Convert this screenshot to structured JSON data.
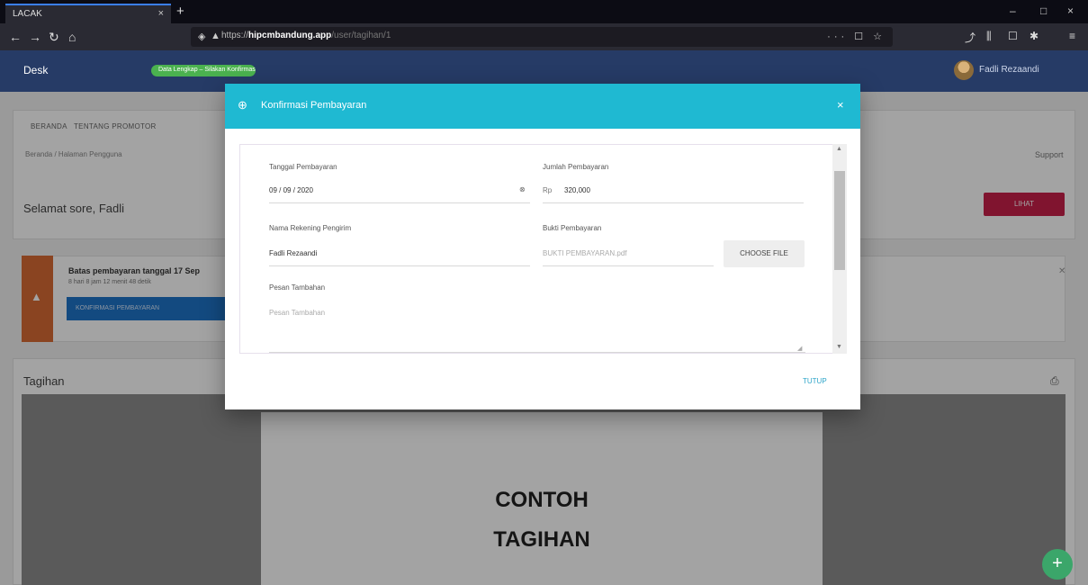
{
  "browser": {
    "tab_title": "LACAK",
    "tab_close": "×",
    "new_tab": "+",
    "window_controls": [
      "–",
      "□",
      "×"
    ],
    "nav": {
      "back": "←",
      "forward": "→",
      "reload": "↻",
      "home": "⌂"
    },
    "url_prefix": "https://",
    "url_host": "hipcmbandung.app",
    "url_path": "/user/tagihan/1",
    "url_actions": "··· ☐ ☆",
    "toolbar_icons": [
      "⤴",
      "⫼",
      "☐",
      "✱",
      "≡"
    ]
  },
  "appbar": {
    "brand": "Desk",
    "status_pill": "Data Lengkap – Silakan Konfirmasi",
    "username": "Fadli Rezaandi"
  },
  "page": {
    "menu": [
      "BERANDA",
      "TENTANG PROMOTOR"
    ],
    "breadcrumb": "Beranda / Halaman Pengguna",
    "support": "Support",
    "greeting": "Selamat sore, Fadli",
    "lihat_button": "LIHAT",
    "alert": {
      "title": "Batas pembayaran tanggal 17 Sep",
      "subtitle": "8 hari 8 jam 12 menit 48 detik",
      "confirm_button": "KONFIRMASI PEMBAYARAN"
    },
    "tagihan_label": "Tagihan",
    "document_lines": [
      "CONTOH",
      "TAGIHAN"
    ]
  },
  "dialog": {
    "title": "Konfirmasi Pembayaran",
    "close": "×",
    "fields": {
      "tanggal_label": "Tanggal Pembayaran",
      "tanggal_value": "09 / 09 / 2020",
      "jumlah_label": "Jumlah Pembayaran",
      "jumlah_prefix": "Rp",
      "jumlah_value": "320,000",
      "nama_label": "Nama Rekening Pengirim",
      "nama_value": "Fadli Rezaandi",
      "bukti_label": "Bukti Pembayaran",
      "bukti_file": "BUKTI PEMBAYARAN.pdf",
      "choose_file": "CHOOSE FILE",
      "pesan_label": "Pesan Tambahan",
      "pesan_placeholder": "Pesan Tambahan"
    },
    "tutup": "TUTUP"
  },
  "colors": {
    "dialog_header": "#1fb9d2",
    "appbar": "#263b66",
    "alert_accent": "#d86b35",
    "primary_button": "#1f74c9",
    "lihat_button": "#c8204a",
    "fab": "#3ba66a"
  },
  "icons": {
    "dialog_header": "plus-circle-icon",
    "tanggal_picker": "calendar-icon",
    "alert": "warning-icon",
    "print": "print-icon",
    "fab": "plus-icon"
  }
}
